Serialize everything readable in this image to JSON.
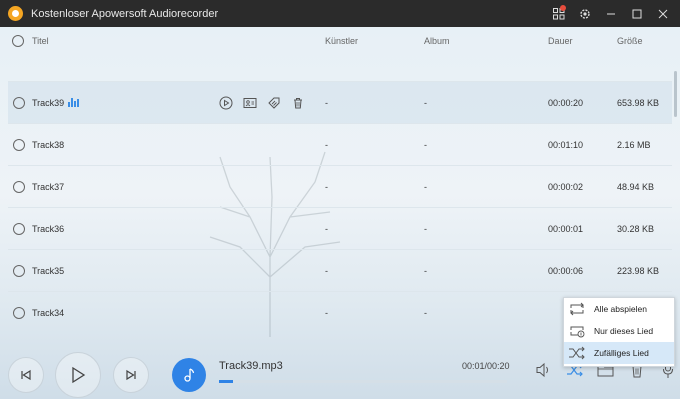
{
  "window": {
    "title": "Kostenloser Apowersoft Audiorecorder"
  },
  "header": {
    "title": "Titel",
    "artist": "Künstler",
    "album": "Album",
    "duration": "Dauer",
    "size": "Größe"
  },
  "tracks": [
    {
      "title": "Track39",
      "artist": "-",
      "album": "-",
      "duration": "00:00:20",
      "size": "653.98 KB",
      "playing": true
    },
    {
      "title": "Track38",
      "artist": "-",
      "album": "-",
      "duration": "00:01:10",
      "size": "2.16 MB"
    },
    {
      "title": "Track37",
      "artist": "-",
      "album": "-",
      "duration": "00:00:02",
      "size": "48.94 KB"
    },
    {
      "title": "Track36",
      "artist": "-",
      "album": "-",
      "duration": "00:00:01",
      "size": "30.28 KB"
    },
    {
      "title": "Track35",
      "artist": "-",
      "album": "-",
      "duration": "00:00:06",
      "size": "223.98 KB"
    },
    {
      "title": "Track34",
      "artist": "-",
      "album": "-",
      "duration": "",
      "size": ""
    }
  ],
  "player": {
    "now_playing": "Track39.mp3",
    "time": "00:01/00:20",
    "progress": 0.05
  },
  "play_mode_menu": {
    "items": [
      "Alle abspielen",
      "Nur dieses Lied",
      "Zufälliges Lied"
    ],
    "selected_index": 2
  },
  "colors": {
    "accent": "#2f83e6",
    "titlebar": "#2b2b2b",
    "app_logo": "#f5a623",
    "notification": "#e74c3c"
  }
}
